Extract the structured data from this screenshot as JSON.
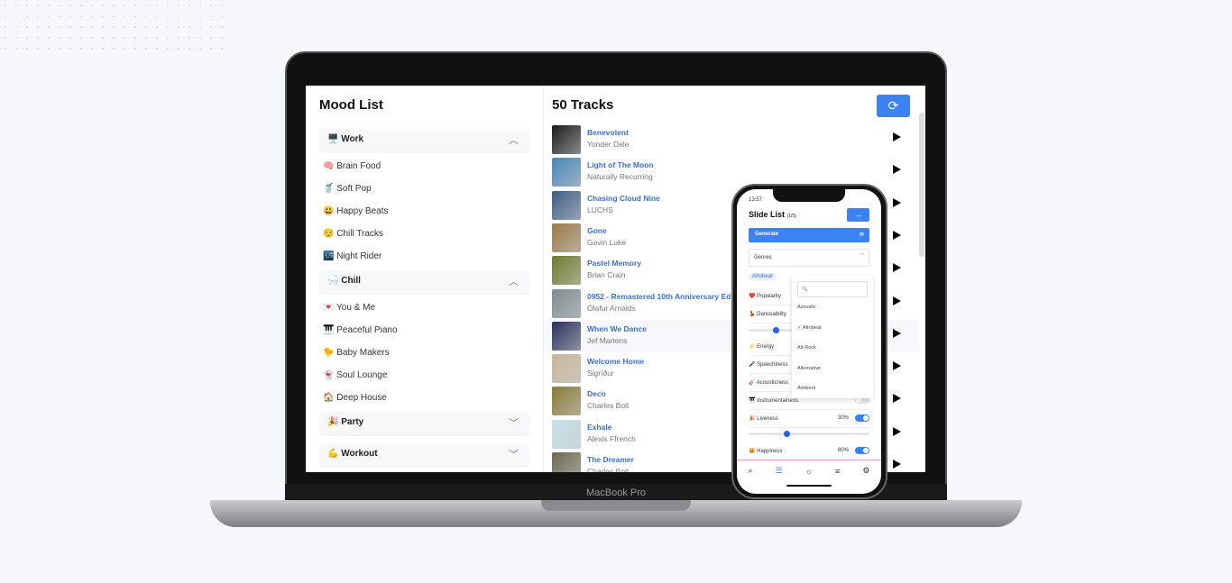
{
  "device_label": "MacBook Pro",
  "mood_list": {
    "title": "Mood List",
    "groups": [
      {
        "label": "🖥️ Work",
        "expanded": true,
        "items": [
          "🧠 Brain Food",
          "🥤 Soft Pop",
          "😃 Happy Beats",
          "😌 Chill Tracks",
          "🌃 Night Rider"
        ]
      },
      {
        "label": "🛁 Chill",
        "expanded": true,
        "items": [
          "💌 You & Me",
          "🎹 Peaceful Piano",
          "🐤 Baby Makers",
          "👻 Soul Lounge",
          "🏠 Deep House"
        ]
      },
      {
        "label": "🎉 Party",
        "expanded": false,
        "items": []
      },
      {
        "label": "💪 Workout",
        "expanded": false,
        "items": []
      }
    ]
  },
  "tracks": {
    "title": "50 Tracks",
    "refresh_icon": "refresh-icon",
    "accent": "#3b82f6",
    "items": [
      {
        "name": "Benevolent",
        "artist": "Yonder Dale",
        "color": "#1c1c1e"
      },
      {
        "name": "Light of The Moon",
        "artist": "Naturally Recurring",
        "color": "#4a86b8"
      },
      {
        "name": "Chasing Cloud Nine",
        "artist": "LUCHS",
        "color": "#3d5f86"
      },
      {
        "name": "Gone",
        "artist": "Gavin Luke",
        "color": "#9a7a4a"
      },
      {
        "name": "Pastel Memory",
        "artist": "Brian Crain",
        "color": "#6d7a2e"
      },
      {
        "name": "0952 - Remastered 10th Anniversary Edition",
        "artist": "Ólafur Arnalds",
        "color": "#7f8c92"
      },
      {
        "name": "When We Dance",
        "artist": "Jef Martens",
        "color": "#2a2f5e"
      },
      {
        "name": "Welcome Home",
        "artist": "Sigríður",
        "color": "#c8b89a"
      },
      {
        "name": "Deco",
        "artist": "Charles Bolt",
        "color": "#8a7a3a"
      },
      {
        "name": "Exhale",
        "artist": "Alexis Ffrench",
        "color": "#c7e0e8"
      },
      {
        "name": "The Dreamer",
        "artist": "Charles Bolt",
        "color": "#6b6a4e"
      }
    ]
  },
  "phone": {
    "time": "13:57",
    "title": "Slide List",
    "count": "(1/5)",
    "generate": "Generate",
    "genres_label": "Genres",
    "selected_chip": "Afrobeat",
    "search_icon": "🔍",
    "genre_options": [
      "Acoustic",
      "✓ Afrobeat",
      "Alt-Rock",
      "Alternative",
      "Ambient"
    ],
    "features": [
      {
        "label": "❤️ Popularity"
      },
      {
        "label": "💃 Danceability"
      },
      {
        "label": "⚡ Energy"
      },
      {
        "label": "🎤 Speechiness"
      },
      {
        "label": "🎸 Acousticness"
      },
      {
        "label": "🎹 Instrumentalness",
        "enabled": false
      },
      {
        "label": "🎉 Liveness",
        "value": "30%",
        "enabled": true
      },
      {
        "label": "😃 Happiness",
        "value": "80%",
        "enabled": true
      }
    ],
    "nav": [
      "⌕",
      "☰",
      "☼",
      "≡",
      "⚙"
    ]
  }
}
